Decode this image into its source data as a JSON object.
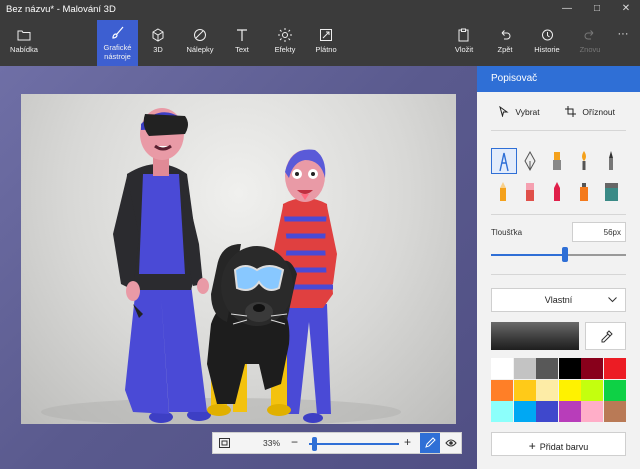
{
  "window": {
    "title": "Bez názvu* - Malování 3D"
  },
  "toolbar": {
    "menu": "Nabídka",
    "brushes": "Grafické\nnástroje",
    "brushes_line1": "Grafické",
    "brushes_line2": "nástroje",
    "three_d": "3D",
    "stickers": "Nálepky",
    "text": "Text",
    "effects": "Efekty",
    "canvas": "Plátno",
    "paste": "Vložit",
    "undo": "Zpět",
    "history": "Historie",
    "redo": "Znovu",
    "more": "···"
  },
  "zoom": {
    "value": "33%",
    "level": 0.06
  },
  "panel": {
    "title": "Popisovač",
    "select": "Vybrat",
    "crop": "Oříznout",
    "thickness_label": "Tloušťka",
    "thickness_value": "56px",
    "thickness_fraction": 0.55,
    "dropdown": "Vlastní",
    "add_color": "Přidat barvu",
    "add_icon": "+"
  },
  "colors": {
    "accent": "#2f6fd6",
    "active_tab": "#3d5fd1",
    "current": "#3a3a3a",
    "palette": [
      "#ffffff",
      "#c3c3c3",
      "#585858",
      "#000000",
      "#88001b",
      "#ec1c24",
      "#ff7f27",
      "#ffca18",
      "#fdeca6",
      "#fff200",
      "#c4ff0e",
      "#0ed145",
      "#8cfffb",
      "#00a8f3",
      "#3f48cc",
      "#b83dba",
      "#ffaec8",
      "#b97a56"
    ]
  }
}
